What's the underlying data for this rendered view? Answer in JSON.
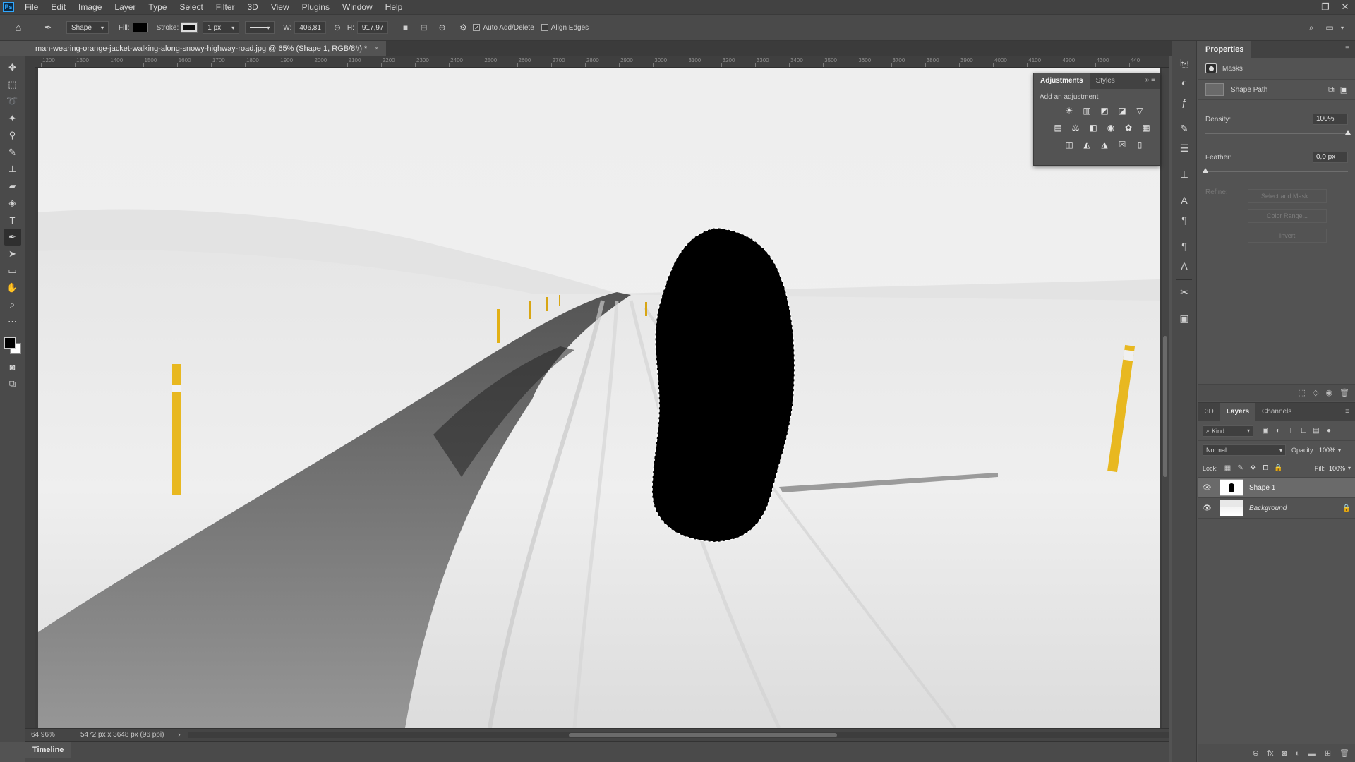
{
  "app": {
    "logo": "Ps"
  },
  "menu": [
    "File",
    "Edit",
    "Image",
    "Layer",
    "Type",
    "Select",
    "Filter",
    "3D",
    "View",
    "Plugins",
    "Window",
    "Help"
  ],
  "window_controls": {
    "minimize": "—",
    "restore": "❐",
    "close": "✕"
  },
  "options": {
    "mode": "Shape",
    "fill_label": "Fill:",
    "stroke_label": "Stroke:",
    "stroke_width": "1 px",
    "w_label": "W:",
    "w_value": "406,81",
    "h_label": "H:",
    "h_value": "917,97",
    "auto_add_delete": "Auto Add/Delete",
    "align_edges": "Align Edges"
  },
  "document": {
    "tab_title": "man-wearing-orange-jacket-walking-along-snowy-highway-road.jpg @ 65% (Shape 1, RGB/8#) *",
    "close": "×"
  },
  "ruler": {
    "top_ticks": [
      "1200",
      "1300",
      "1400",
      "1500",
      "1600",
      "1700",
      "1800",
      "1900",
      "2000",
      "2100",
      "2200",
      "2300",
      "2400",
      "2500",
      "2600",
      "2700",
      "2800",
      "2900",
      "3000",
      "3100",
      "3200",
      "3300",
      "3400",
      "3500",
      "3600",
      "3700",
      "3800",
      "3900",
      "4000",
      "4100",
      "4200",
      "4300",
      "440"
    ]
  },
  "status": {
    "zoom": "64,96%",
    "doc_info": "5472 px x 3648 px (96 ppi)",
    "arrow": "›"
  },
  "timeline": {
    "label": "Timeline"
  },
  "adjustments_panel": {
    "tabs": [
      "Adjustments",
      "Styles"
    ],
    "subtitle": "Add an adjustment",
    "icons_row1": [
      "☀",
      "▥",
      "◩",
      "◪",
      "▽"
    ],
    "icons_row2": [
      "▤",
      "⚖",
      "◧",
      "◉",
      "✿",
      "▦"
    ],
    "icons_row3": [
      "◫",
      "◭",
      "◮",
      "☒",
      "▯"
    ]
  },
  "properties": {
    "title": "Properties",
    "masks_label": "Masks",
    "shape_path_label": "Shape Path",
    "density_label": "Density:",
    "density_value": "100%",
    "density_level": 1.0,
    "feather_label": "Feather:",
    "feather_value": "0,0 px",
    "feather_level": 0.0,
    "refine_label": "Refine:",
    "select_and_mask": "Select and Mask...",
    "color_range": "Color Range...",
    "invert": "Invert"
  },
  "layers_panel": {
    "tabs": [
      "3D",
      "Layers",
      "Channels"
    ],
    "kind_label": "Kind",
    "blend_mode": "Normal",
    "opacity_label": "Opacity:",
    "opacity_value": "100%",
    "lock_label": "Lock:",
    "fill_label": "Fill:",
    "fill_value": "100%",
    "layers": [
      {
        "name": "Shape 1",
        "visible": true,
        "selected": true
      },
      {
        "name": "Background",
        "visible": true,
        "locked": true
      }
    ]
  },
  "colors": {
    "accent": "#31a8ff",
    "pole_yellow": "#e8b820",
    "mask_black": "#000000"
  }
}
